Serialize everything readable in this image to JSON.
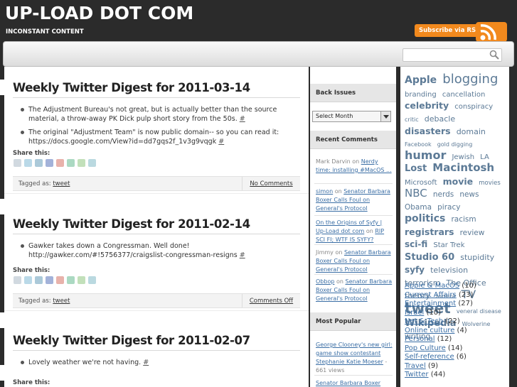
{
  "header": {
    "title": "UP-LOAD DOT COM",
    "tagline": "INCONSTANT CONTENT",
    "rss_label": "Subscribe via RSS"
  },
  "posts": [
    {
      "title": "Weekly Twitter Digest for 2011-03-14",
      "items": [
        {
          "text": "The Adjustment Bureau's not great, but is actually better than the source material, a throw-away PK Dick pulp short story from the 50s.",
          "link": "#"
        },
        {
          "text": "The original \"Adjustment Team\" is now public domain-- so you can read it: https://docs.google.com/View?id=dd7gqs2f_1v3g9vqgk",
          "link": "#"
        }
      ],
      "share_label": "Share this:",
      "tagged_label": "Tagged as:",
      "tag": "tweet",
      "comments": "No Comments"
    },
    {
      "title": "Weekly Twitter Digest for 2011-02-14",
      "items": [
        {
          "text": "Gawker takes down a Congressman. Well done! http://gawker.com/#!5756377/craigslist-congressman-resigns",
          "link": "#"
        }
      ],
      "share_label": "Share this:",
      "tagged_label": "Tagged as:",
      "tag": "tweet",
      "comments": "Comments Off"
    },
    {
      "title": "Weekly Twitter Digest for 2011-02-07",
      "items": [
        {
          "text": "Lovely weather we're not having.",
          "link": "#"
        }
      ],
      "share_label": "Share this:"
    }
  ],
  "sidebar": {
    "back_issues": {
      "heading": "Back Issues",
      "select_value": "Select Month"
    },
    "recent_comments": {
      "heading": "Recent Comments",
      "items": [
        {
          "author": "Mark Darvin",
          "on": "on",
          "post": "Nerdy time: installing #MacOS ..."
        },
        {
          "author": "simon",
          "on": "on",
          "post": "Senator Barbara Boxer Calls Foul on General's Protocol"
        },
        {
          "author": "On the Origins of Syfy | Up-Load dot com",
          "on": "on",
          "post": "RIP SCI FI; WTF IS SYFY?"
        },
        {
          "author": "Jimmy",
          "on": "on",
          "post": "Senator Barbara Boxer Calls Foul on General's Protocol"
        },
        {
          "author": "Obbop",
          "on": "on",
          "post": "Senator Barbara Boxer Calls Foul on General's Protocol"
        }
      ]
    },
    "most_popular": {
      "heading": "Most Popular",
      "items": [
        {
          "title": "George Clooney's new girl: game show contestant Stephanie Katie Moeser",
          "views": "- 661 views"
        },
        {
          "title": "Senator Barbara Boxer",
          "views": ""
        }
      ]
    },
    "tags": [
      {
        "label": "Apple",
        "size": 14,
        "weight": "bold"
      },
      {
        "label": "blogging",
        "size": 18,
        "weight": "normal"
      },
      {
        "label": "branding",
        "size": 10,
        "weight": "normal"
      },
      {
        "label": "cancellation",
        "size": 10,
        "weight": "normal"
      },
      {
        "label": "celebrity",
        "size": 12.5,
        "weight": "bold"
      },
      {
        "label": "conspiracy",
        "size": 10,
        "weight": "normal"
      },
      {
        "label": "critic",
        "size": 8,
        "weight": "normal"
      },
      {
        "label": "debacle",
        "size": 11,
        "weight": "normal"
      },
      {
        "label": "disasters",
        "size": 12.5,
        "weight": "bold"
      },
      {
        "label": "domain",
        "size": 11,
        "weight": "normal"
      },
      {
        "label": "Facebook",
        "size": 8,
        "weight": "normal"
      },
      {
        "label": "gold digging",
        "size": 8,
        "weight": "normal"
      },
      {
        "label": "humor",
        "size": 16,
        "weight": "bold"
      },
      {
        "label": "Jewish",
        "size": 10,
        "weight": "normal"
      },
      {
        "label": "LA",
        "size": 10,
        "weight": "normal"
      },
      {
        "label": "Lost",
        "size": 13,
        "weight": "bold"
      },
      {
        "label": "Macintosh",
        "size": 15,
        "weight": "bold"
      },
      {
        "label": "Microsoft",
        "size": 10,
        "weight": "normal"
      },
      {
        "label": "movie",
        "size": 12.5,
        "weight": "bold"
      },
      {
        "label": "movies",
        "size": 8.5,
        "weight": "normal"
      },
      {
        "label": "NBC",
        "size": 15,
        "weight": "normal"
      },
      {
        "label": "nerds",
        "size": 10.5,
        "weight": "normal"
      },
      {
        "label": "news",
        "size": 10.5,
        "weight": "normal"
      },
      {
        "label": "Obama",
        "size": 10.5,
        "weight": "normal"
      },
      {
        "label": "piracy",
        "size": 10.5,
        "weight": "normal"
      },
      {
        "label": "politics",
        "size": 14,
        "weight": "bold"
      },
      {
        "label": "racism",
        "size": 10.5,
        "weight": "normal"
      },
      {
        "label": "registrars",
        "size": 12.5,
        "weight": "bold"
      },
      {
        "label": "review",
        "size": 10.5,
        "weight": "normal"
      },
      {
        "label": "sci-fi",
        "size": 12,
        "weight": "bold"
      },
      {
        "label": "Star Trek",
        "size": 10,
        "weight": "normal"
      },
      {
        "label": "Studio 60",
        "size": 13,
        "weight": "bold"
      },
      {
        "label": "stupidity",
        "size": 11,
        "weight": "normal"
      },
      {
        "label": "syfy",
        "size": 12,
        "weight": "bold"
      },
      {
        "label": "television",
        "size": 11,
        "weight": "normal"
      },
      {
        "label": "terrorism",
        "size": 11,
        "weight": "normal"
      },
      {
        "label": "The Office",
        "size": 11,
        "weight": "normal"
      },
      {
        "label": "theory",
        "size": 11,
        "weight": "normal"
      },
      {
        "label": "torrent",
        "size": 8,
        "weight": "normal"
      },
      {
        "label": "TV",
        "size": 16,
        "weight": "normal"
      },
      {
        "label": "tweet",
        "size": 20,
        "weight": "bold"
      },
      {
        "label": "veneral disease",
        "size": 8,
        "weight": "normal"
      },
      {
        "label": "Wikipedia",
        "size": 13,
        "weight": "bold"
      },
      {
        "label": "Wolverine",
        "size": 8,
        "weight": "normal"
      },
      {
        "label": "writing",
        "size": 10.5,
        "weight": "normal"
      }
    ],
    "tag_color": "#5c7a96",
    "categories": [
      {
        "name": "Apple & MacOS",
        "count": "(10)"
      },
      {
        "name": "Current Affairs",
        "count": "(23)"
      },
      {
        "name": "Entertainment",
        "count": "(27)"
      },
      {
        "name": "Israel",
        "count": "(10)"
      },
      {
        "name": "Net & Tech",
        "count": "(22)"
      },
      {
        "name": "Online culture",
        "count": "(4)"
      },
      {
        "name": "Personal",
        "count": "(12)"
      },
      {
        "name": "Pop Culture",
        "count": "(14)"
      },
      {
        "name": "Self-reference",
        "count": "(6)"
      },
      {
        "name": "Travel",
        "count": "(9)"
      },
      {
        "name": "Twitter",
        "count": "(44)"
      }
    ]
  },
  "colors": {
    "background": "#2b2b2b",
    "accent_rss": "#f2891d",
    "link": "#3a6ea5"
  }
}
